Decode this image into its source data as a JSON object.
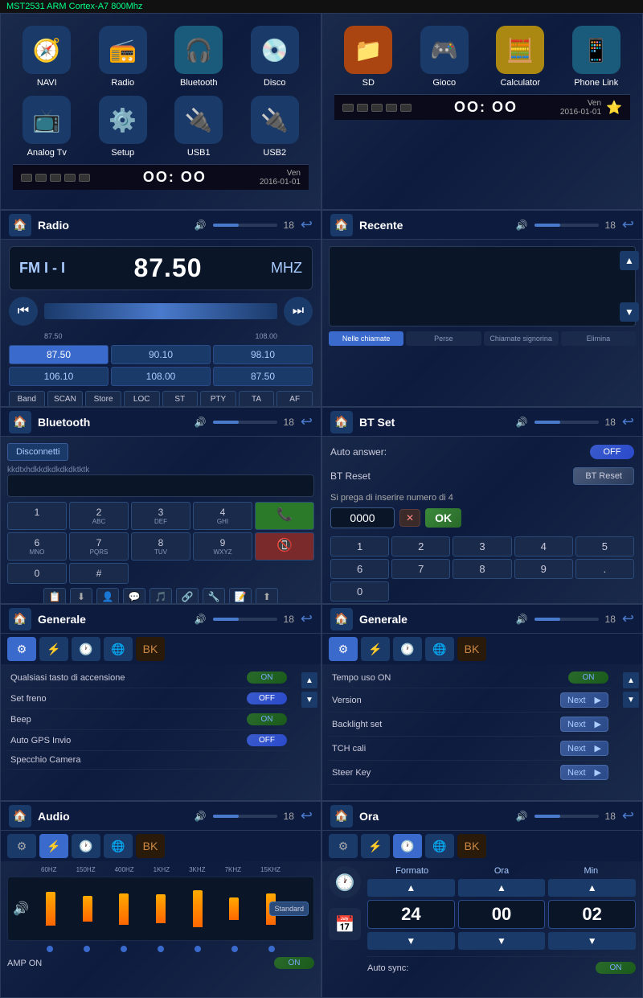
{
  "header": {
    "title": "MST2531 ARM Cortex-A7 800Mhz",
    "title_color": "#00ff88"
  },
  "home1": {
    "icons": [
      {
        "label": "NAVI",
        "emoji": "🧭",
        "bg": "#2a4a8a"
      },
      {
        "label": "Radio",
        "emoji": "📻",
        "bg": "#2a4a8a"
      },
      {
        "label": "Bluetooth",
        "emoji": "🎧",
        "bg": "#2a6a8a"
      },
      {
        "label": "Disco",
        "emoji": "💿",
        "bg": "#2a4a8a"
      },
      {
        "label": "Analog Tv",
        "emoji": "📺",
        "bg": "#2a4a8a"
      },
      {
        "label": "Setup",
        "emoji": "⚙️",
        "bg": "#2a4a8a"
      },
      {
        "label": "USB1",
        "emoji": "🔌",
        "bg": "#2a4a8a"
      },
      {
        "label": "USB2",
        "emoji": "🔌",
        "bg": "#2a4a8a"
      }
    ],
    "status": {
      "time": "OO: OO",
      "date": "Ven\n2016-01-01"
    }
  },
  "home2": {
    "icons": [
      {
        "label": "SD",
        "emoji": "📁",
        "bg": "#cc6622"
      },
      {
        "label": "Gioco",
        "emoji": "🎮",
        "bg": "#2a4a8a"
      },
      {
        "label": "Calculator",
        "emoji": "🧮",
        "bg": "#cc9922"
      },
      {
        "label": "Phone Link",
        "emoji": "📱",
        "bg": "#2a6a8a"
      }
    ],
    "status": {
      "time": "OO: OO",
      "date": "Ven\n2016-01-01",
      "star_icon": "⭐"
    }
  },
  "radio": {
    "title": "Radio",
    "band": "FM I - I",
    "freq": "87.50",
    "unit": "MHZ",
    "range_start": "87.50",
    "range_end": "108.00",
    "presets": [
      "87.50",
      "90.10",
      "98.10",
      "106.10",
      "108.00",
      "87.50"
    ],
    "active_preset": "87.50",
    "controls": [
      "Band",
      "SCAN",
      "Store",
      "LOC",
      "ST",
      "PTY",
      "TA",
      "AF"
    ],
    "vol": 18
  },
  "recente": {
    "title": "Recente",
    "tabs": [
      "Nelle chiamate",
      "Perse",
      "Chiamate signorina",
      "Elimina"
    ],
    "active_tab": "Nelle chiamate",
    "vol": 18
  },
  "bluetooth": {
    "title": "Bluetooth",
    "disconnect_btn": "Disconnetti",
    "device_id": "kkdtxhdkkdkdkdkdktktk",
    "keys": [
      {
        "main": "1",
        "sub": ""
      },
      {
        "main": "2",
        "sub": "ABC"
      },
      {
        "main": "3",
        "sub": "DEF"
      },
      {
        "main": "4",
        "sub": "GHI"
      },
      {
        "main": "✱",
        "sub": ""
      },
      {
        "main": "6",
        "sub": "MNO"
      },
      {
        "main": "7",
        "sub": "PQRS"
      },
      {
        "main": "8",
        "sub": "TUV"
      },
      {
        "main": "9",
        "sub": "WXYZ"
      },
      {
        "main": "0",
        "sub": ""
      },
      {
        "main": "#",
        "sub": ""
      }
    ],
    "call_icon": "📞",
    "hangup_icon": "📵",
    "bottom_icons": [
      "📋",
      "⬇️",
      "👤",
      "💬",
      "🎵",
      "📝",
      "⬆️"
    ],
    "vol": 18
  },
  "btset": {
    "title": "BT Set",
    "auto_answer_label": "Auto answer:",
    "auto_answer_value": "OFF",
    "bt_reset_label": "BT Reset",
    "bt_reset_btn": "BT Reset",
    "pin_hint": "Si prega di inserire numero di 4",
    "pin_value": "0000",
    "ok_btn": "OK",
    "numpad": [
      "1",
      "2",
      "3",
      "4",
      "5",
      "6",
      "7",
      "8",
      "9",
      ".",
      "0"
    ],
    "vol": 18
  },
  "generale1": {
    "title": "Generale",
    "vol": 18,
    "rows": [
      {
        "label": "Qualsiasi tasto di accensione",
        "value": "ON",
        "type": "toggle_on"
      },
      {
        "label": "Set freno",
        "value": "OFF",
        "type": "toggle_off"
      },
      {
        "label": "Beep",
        "value": "ON",
        "type": "toggle_on"
      },
      {
        "label": "Auto GPS Invio",
        "value": "OFF",
        "type": "toggle_off"
      },
      {
        "label": "Specchio Camera",
        "value": "",
        "type": "empty"
      }
    ]
  },
  "generale2": {
    "title": "Generale",
    "vol": 18,
    "rows": [
      {
        "label": "Tempo uso ON",
        "value": "ON",
        "type": "toggle_on"
      },
      {
        "label": "Version",
        "value": "Next",
        "type": "next"
      },
      {
        "label": "Backlight set",
        "value": "Next",
        "type": "next"
      },
      {
        "label": "TCH cali",
        "value": "Next",
        "type": "next"
      },
      {
        "label": "Steer Key",
        "value": "Next",
        "type": "next"
      }
    ]
  },
  "audio": {
    "title": "Audio",
    "vol": 18,
    "eq_labels": [
      "60HZ",
      "150HZ",
      "400HZ",
      "1KHZ",
      "3KHZ",
      "7KHZ",
      "15KHZ"
    ],
    "eq_heights": [
      55,
      40,
      50,
      45,
      60,
      35,
      50
    ],
    "preset": "Standard",
    "amp_on_label": "AMP ON",
    "amp_value": "ON"
  },
  "ora": {
    "title": "Ora",
    "vol": 18,
    "col_headers": [
      "Formato",
      "Ora",
      "Min"
    ],
    "formato_value": "24",
    "ora_value": "00",
    "min_value": "02",
    "auto_sync_label": "Auto sync:",
    "auto_sync_value": "ON"
  },
  "labels": {
    "next": "Next",
    "on": "ON",
    "off": "OFF",
    "bk": "BK"
  }
}
